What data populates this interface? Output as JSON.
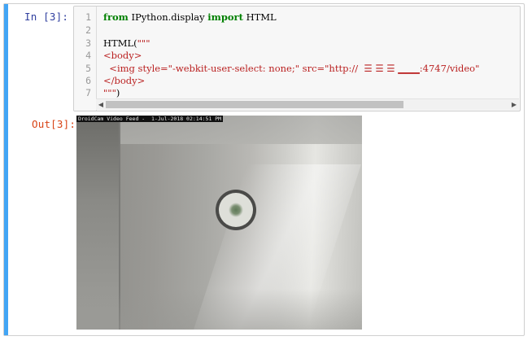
{
  "cell": {
    "in_prompt": "In  [3]:",
    "out_prompt": "Out[3]:",
    "accent_color": "#42a5f5",
    "line_numbers": [
      "1",
      "2",
      "3",
      "4",
      "5",
      "6",
      "7"
    ],
    "code": {
      "line1_kw1": "from",
      "line1_mid": " IPython.display ",
      "line1_kw2": "import",
      "line1_end": " HTML",
      "line3_call": "HTML(",
      "line3_str": "\"\"\"",
      "line4": "<body>",
      "line5": "  <img style=\"-webkit-user-select: none;\" src=\"http://  ☰ ☰ ☰ ▁▁▁:4747/video\"",
      "line6": "</body>",
      "line7_str": "\"\"\"",
      "line7_end": ")"
    }
  },
  "output": {
    "feed_label": "DroidCam Video Feed -  1-Jul-2018 02:14:51 PM",
    "image_description_icon": "webcam-frame"
  }
}
